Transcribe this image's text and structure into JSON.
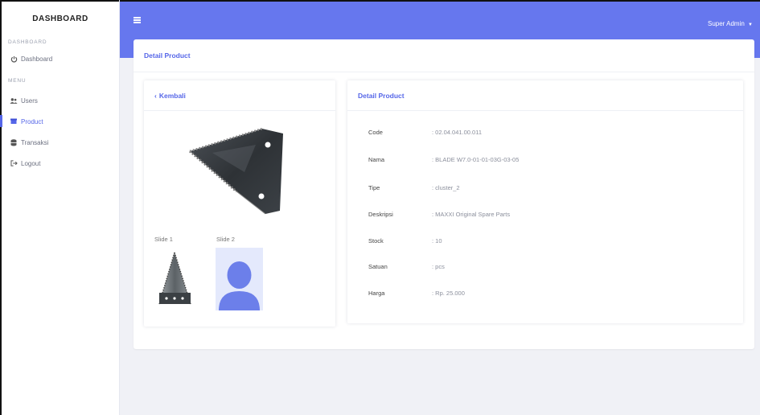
{
  "sidebar": {
    "brand": "DASHBOARD",
    "section_dashboard": "DASHBOARD",
    "item_dashboard": "Dashboard",
    "section_menu": "MENU",
    "items": [
      {
        "label": "Users",
        "icon": "users-icon"
      },
      {
        "label": "Product",
        "icon": "box-icon"
      },
      {
        "label": "Transaksi",
        "icon": "database-icon"
      },
      {
        "label": "Logout",
        "icon": "logout-icon"
      }
    ]
  },
  "topbar": {
    "user": "Super Admin",
    "accent": "#6677ee"
  },
  "main": {
    "title": "Detail Product"
  },
  "left_card": {
    "back_label": "Kembali",
    "slide1": "Slide 1",
    "slide2": "Slide 2"
  },
  "detail": {
    "title": "Detail Product",
    "fields": [
      {
        "label": "Code",
        "value": ": 02.04.041.00.011"
      },
      {
        "label": "Nama",
        "value": ": BLADE W7.0-01-01-03G-03-05"
      },
      {
        "label": "Tipe",
        "value": ": cluster_2"
      },
      {
        "label": "Deskripsi",
        "value": ": MAXXI Original Spare Parts"
      },
      {
        "label": "Stock",
        "value": ": 10"
      },
      {
        "label": "Satuan",
        "value": ": pcs"
      },
      {
        "label": "Harga",
        "value": ": Rp. 25.000"
      }
    ]
  }
}
